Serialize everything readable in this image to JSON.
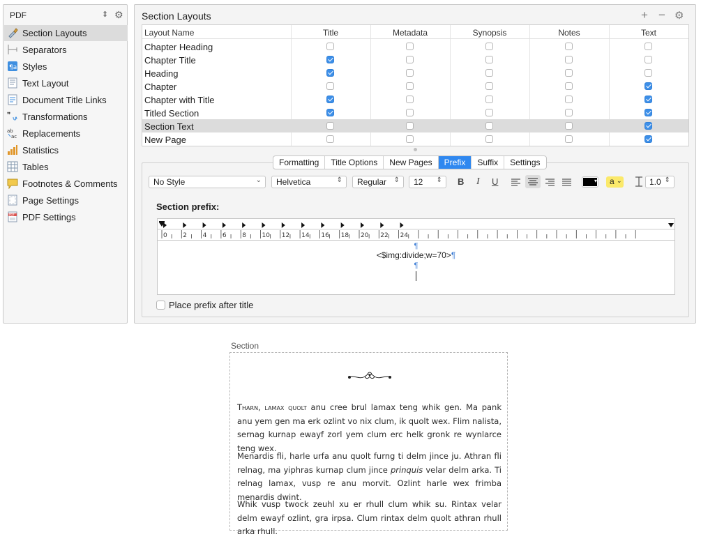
{
  "sidebar": {
    "format_select": "PDF",
    "items": [
      {
        "label": "Section Layouts",
        "icon": "brush-icon",
        "selected": true
      },
      {
        "label": "Separators",
        "icon": "separators-icon"
      },
      {
        "label": "Styles",
        "icon": "styles-icon"
      },
      {
        "label": "Text Layout",
        "icon": "text-layout-icon"
      },
      {
        "label": "Document Title Links",
        "icon": "document-links-icon"
      },
      {
        "label": "Transformations",
        "icon": "transformations-icon"
      },
      {
        "label": "Replacements",
        "icon": "replacements-icon"
      },
      {
        "label": "Statistics",
        "icon": "bar-chart-icon"
      },
      {
        "label": "Tables",
        "icon": "table-icon"
      },
      {
        "label": "Footnotes & Comments",
        "icon": "note-icon"
      },
      {
        "label": "Page Settings",
        "icon": "page-icon"
      },
      {
        "label": "PDF Settings",
        "icon": "pdf-icon"
      }
    ]
  },
  "panel": {
    "title": "Section Layouts",
    "add": "+",
    "remove": "−",
    "gear": "⚙"
  },
  "table": {
    "columns": [
      "Layout Name",
      "Title",
      "Metadata",
      "Synopsis",
      "Notes",
      "Text"
    ],
    "rows": [
      {
        "name": "Chapter Heading",
        "checks": [
          false,
          false,
          false,
          false,
          false
        ]
      },
      {
        "name": "Chapter Title",
        "checks": [
          true,
          false,
          false,
          false,
          false
        ]
      },
      {
        "name": "Heading",
        "checks": [
          true,
          false,
          false,
          false,
          false
        ]
      },
      {
        "name": "Chapter",
        "checks": [
          false,
          false,
          false,
          false,
          true
        ]
      },
      {
        "name": "Chapter with Title",
        "checks": [
          true,
          false,
          false,
          false,
          true
        ]
      },
      {
        "name": "Titled Section",
        "checks": [
          true,
          false,
          false,
          false,
          true
        ]
      },
      {
        "name": "Section Text",
        "checks": [
          false,
          false,
          false,
          false,
          true
        ],
        "selected": true
      },
      {
        "name": "New Page",
        "checks": [
          false,
          false,
          false,
          false,
          true
        ]
      }
    ]
  },
  "tabs": [
    "Formatting",
    "Title Options",
    "New Pages",
    "Prefix",
    "Suffix",
    "Settings"
  ],
  "active_tab": "Prefix",
  "toolbar": {
    "style": "No Style",
    "font": "Helvetica",
    "weight": "Regular",
    "size": "12",
    "bold": "B",
    "italic": "I",
    "underline": "U",
    "highlight": "a",
    "line_spacing": "1.0",
    "text_color": "#000000",
    "highlight_color": "#fbe96a"
  },
  "prefix": {
    "label": "Section prefix:",
    "ruler_labels": [
      "0",
      "2",
      "4",
      "6",
      "8",
      "10",
      "12",
      "14",
      "16",
      "18",
      "20",
      "22",
      "24"
    ],
    "lines": [
      "¶",
      "<$img:divide;w=70>¶",
      "¶"
    ],
    "place_after_title": "Place prefix after title",
    "place_after_checked": false
  },
  "preview": {
    "label": "Section",
    "ornament": "ornament-divider-icon",
    "paragraphs": [
      {
        "smallcaps": "Tharn, lamax quolt",
        "text": " anu cree brul lamax teng whik gen. Ma pank anu yem gen ma erk ozlint vo nix clum, ik quolt wex. Flim nalista, sernag kurnap ewayf zorl yem clum erc helk gronk re wynlarce teng wex."
      },
      {
        "before": "Menardis fli, harle urfa anu quolt furng ti delm jince ju. Athran fli relnag, ma yiphras kurnap clum jince ",
        "italic": "prinquis",
        "after": " velar delm arka. Ti relnag lamax, vusp re anu morvit. Ozlint harle wex frimba menardis dwint."
      },
      {
        "text": "Whik vusp twock zeuhl xu er rhull clum whik su. Rintax velar delm ewayf ozlint, gra irpsa. Clum rintax delm quolt athran rhull arka rhull."
      }
    ]
  }
}
